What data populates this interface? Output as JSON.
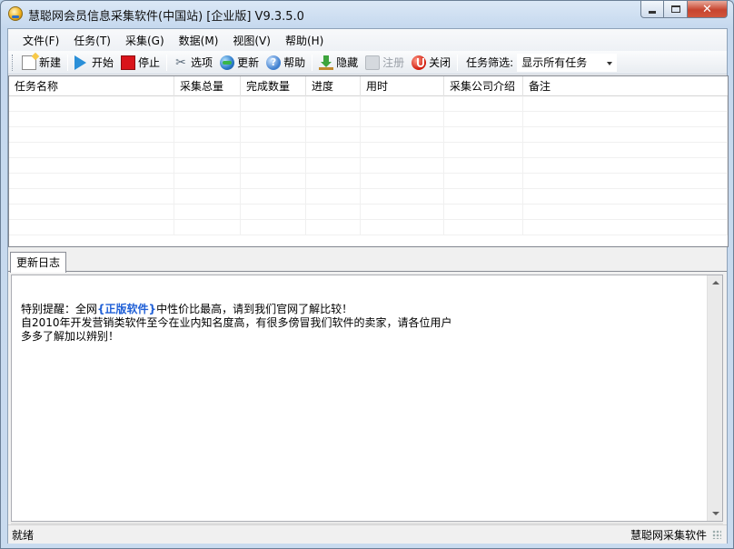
{
  "window": {
    "title": "慧聪网会员信息采集软件(中国站) [企业版] V9.3.5.0",
    "close_glyph": "✕"
  },
  "menu": {
    "items": [
      "文件(F)",
      "任务(T)",
      "采集(G)",
      "数据(M)",
      "视图(V)",
      "帮助(H)"
    ]
  },
  "toolbar": {
    "new": "新建",
    "start": "开始",
    "stop": "停止",
    "options": "选项",
    "update": "更新",
    "help": "帮助",
    "help_glyph": "?",
    "options_glyph": "✂",
    "hide": "隐藏",
    "register": "注册",
    "close": "关闭",
    "filter_label": "任务筛选:",
    "filter_value": "显示所有任务"
  },
  "table": {
    "columns": [
      "任务名称",
      "采集总量",
      "完成数量",
      "进度",
      "用时",
      "采集公司介绍",
      "备注"
    ]
  },
  "tabs": {
    "update_log": "更新日志"
  },
  "log": {
    "line1_prefix": "特别提醒：全网",
    "line1_highlight": "{正版软件}",
    "line1_suffix": "中性价比最高，请到我们官网了解比较！",
    "line2": "自2010年开发营销类软件至今在业内知名度高，有很多傍冒我们软件的卖家，请各位用户",
    "line3": "多多了解加以辨别！"
  },
  "status": {
    "left": "就绪",
    "right": "慧聪网采集软件"
  },
  "colors": {
    "highlight": "#1f5fd6",
    "stop_red": "#d9141b",
    "start_blue": "#2a8fd8"
  }
}
